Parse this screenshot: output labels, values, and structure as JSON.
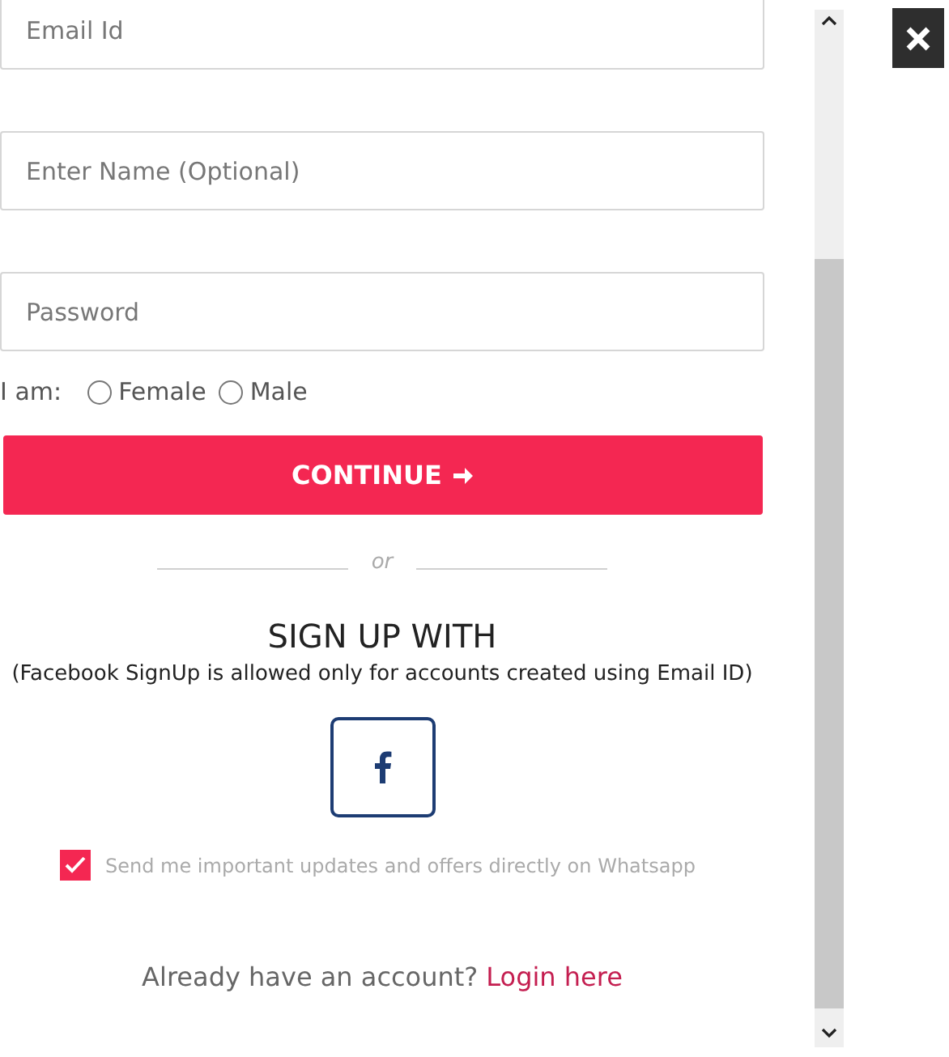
{
  "fields": [
    {
      "placeholder": "Email Id"
    },
    {
      "placeholder": "Enter Name (Optional)"
    },
    {
      "placeholder": "Password"
    }
  ],
  "gender": {
    "label": "I am:",
    "options": [
      {
        "label": "Female",
        "selected": false
      },
      {
        "label": "Male",
        "selected": false
      }
    ]
  },
  "continue_button": {
    "label": "CONTINUE"
  },
  "divider": {
    "label": "or"
  },
  "signup": {
    "title": "SIGN UP WITH",
    "note": "(Facebook SignUp is allowed only for accounts created using Email ID)"
  },
  "whatsapp": {
    "label": "Send me important updates and offers directly on Whatsapp",
    "checked": true
  },
  "login": {
    "prompt": "Already have an account?",
    "link": "Login here"
  }
}
